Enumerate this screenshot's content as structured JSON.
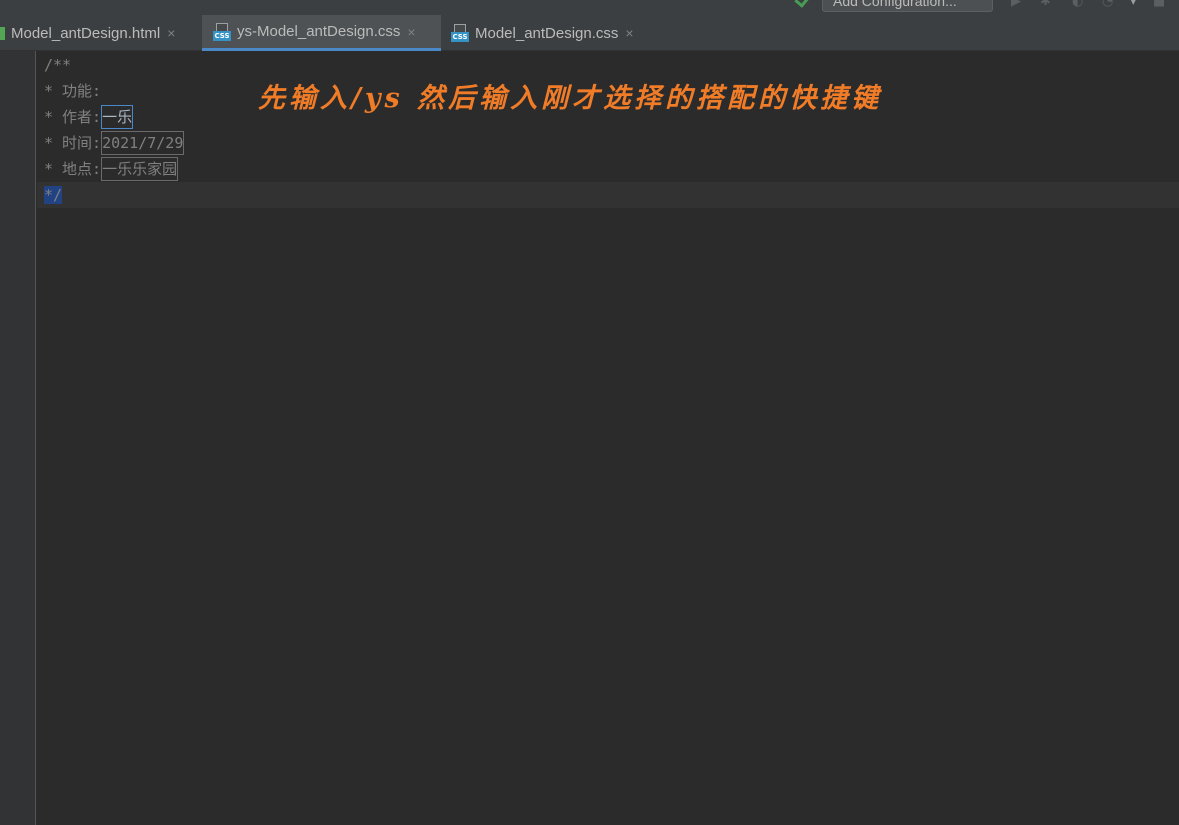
{
  "toolbar": {
    "config_label": "Add Configuration...",
    "icons": [
      "run-icon",
      "debug-icon",
      "coverage-icon",
      "profile-icon",
      "dropdown-icon",
      "stop-icon"
    ]
  },
  "tabs": [
    {
      "label": "Model_antDesign.html",
      "icon": "html-file-icon",
      "active": false
    },
    {
      "label": "ys-Model_antDesign.css",
      "icon": "css-file-icon",
      "active": true
    },
    {
      "label": "Model_antDesign.css",
      "icon": "css-file-icon",
      "active": false
    }
  ],
  "tab_close_glyph": "×",
  "file_icon_badge": "CSS",
  "editor": {
    "line1": "/**",
    "line2": "* 功能:",
    "line3_prefix": "* 作者:",
    "line3_var": "一乐",
    "line4_prefix": "* 时间:",
    "line4_var": "2021/7/29",
    "line5_prefix": "* 地点:",
    "line5_var": "一乐乐家园",
    "line6": "*/"
  },
  "overlay_caption": "先输入/ys 然后输入刚才选择的搭配的快捷键",
  "colors": {
    "background": "#2b2b2b",
    "tabbar": "#3c3f41",
    "active_tab_underline": "#4a88c7",
    "comment_text": "#808080",
    "caption": "#f07c28",
    "selection": "#214283"
  }
}
